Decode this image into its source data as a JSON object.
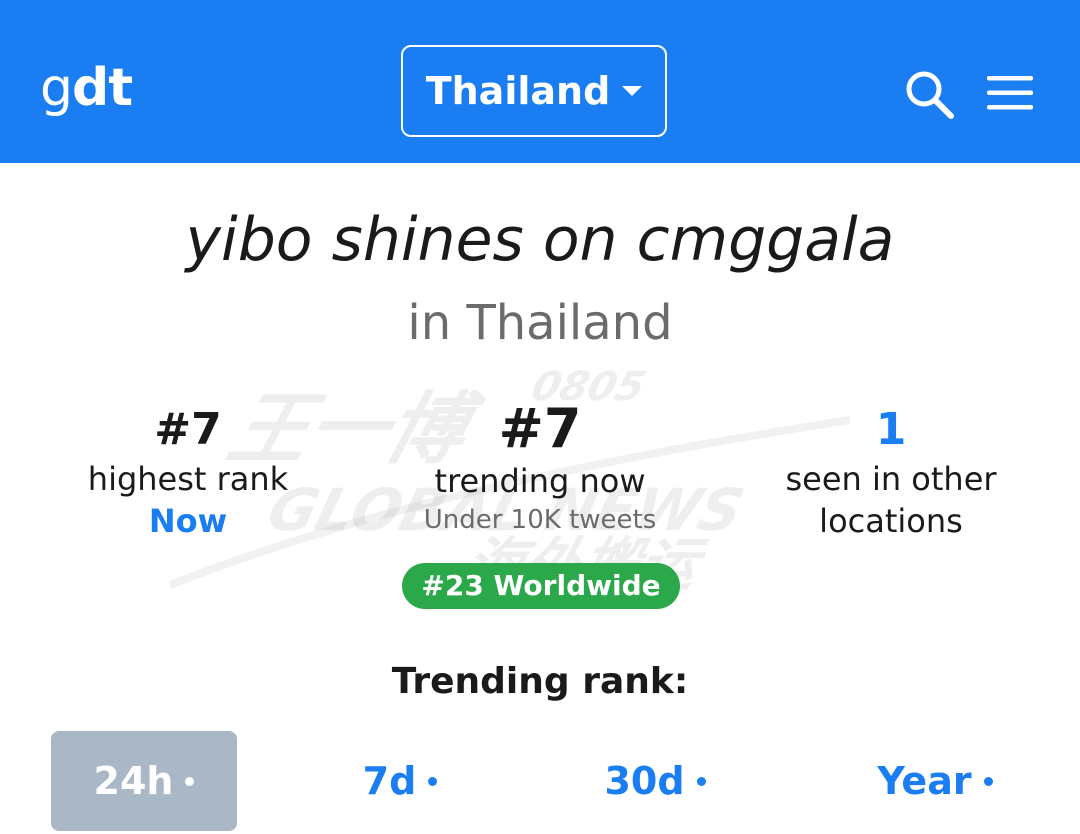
{
  "header": {
    "logo_g": "g",
    "logo_dt": "dt",
    "country": "Thailand",
    "accent_color": "#1a7ef2"
  },
  "trend": {
    "title": "yibo shines on cmggala",
    "location": "in Thailand"
  },
  "stats": {
    "highest_rank_value": "#7",
    "highest_rank_label": "highest rank",
    "highest_rank_when": "Now",
    "trending_now_value": "#7",
    "trending_now_label": "trending now",
    "trending_now_volume": "Under 10K tweets",
    "worldwide_badge": "#23 Worldwide",
    "other_locations_value": "1",
    "other_locations_label_1": "seen in other",
    "other_locations_label_2": "locations"
  },
  "watermark": {
    "line1": "王一博",
    "line2": "0805",
    "line3": "GLOBAL NEWS",
    "line4": "海外搬运"
  },
  "rank_section": {
    "heading": "Trending rank:",
    "tabs": [
      {
        "label": "24h",
        "active": true
      },
      {
        "label": "7d",
        "active": false
      },
      {
        "label": "30d",
        "active": false
      },
      {
        "label": "Year",
        "active": false
      }
    ]
  },
  "icons": {
    "search": "search-icon",
    "menu": "hamburger-menu-icon",
    "caret": "caret-down-icon"
  },
  "colors": {
    "primary_blue": "#1a7ef2",
    "badge_green": "#2aa84a",
    "active_tab_gray": "#a9b7c6"
  }
}
